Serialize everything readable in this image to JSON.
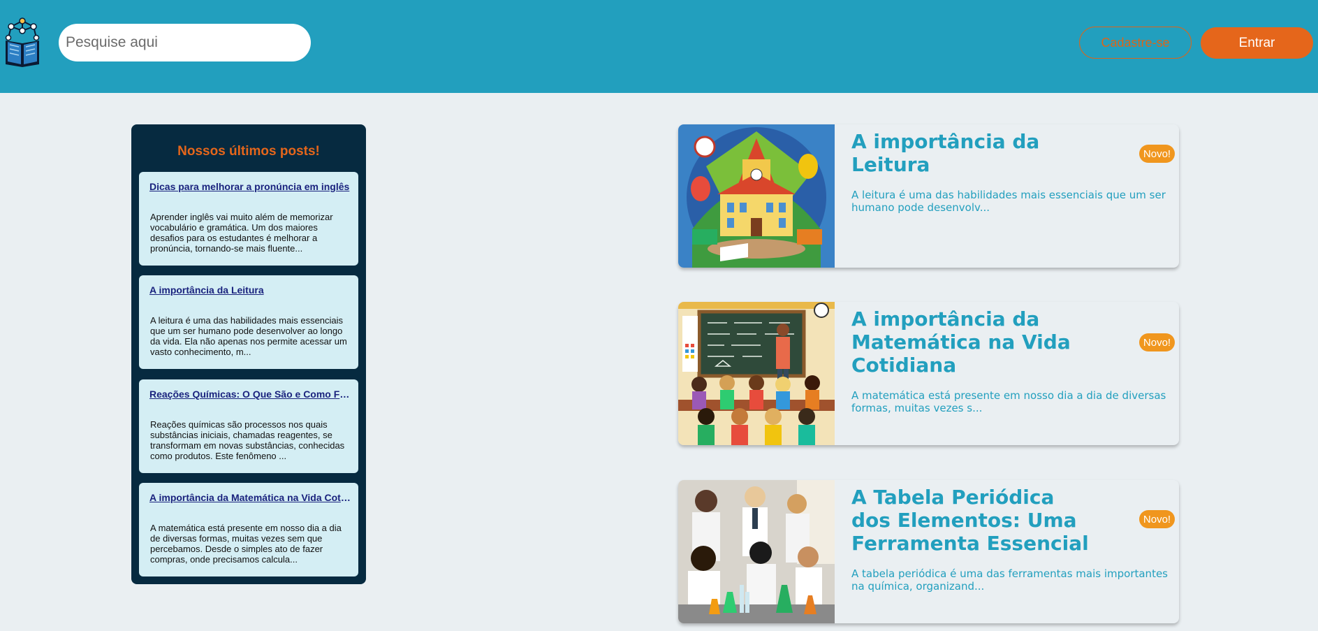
{
  "header": {
    "logo_icon": "book-network-icon",
    "search_placeholder": "Pesquise aqui",
    "signup_label": "Cadastre-se",
    "login_label": "Entrar"
  },
  "sidebar": {
    "title": "Nossos últimos posts!",
    "posts": [
      {
        "title": "Dicas para melhorar a pronúncia em inglês",
        "excerpt": "Aprender inglês vai muito além de memorizar vocabulário e gramática. Um dos maiores desafios para os estudantes é melhorar a pronúncia, tornando-se mais fluente..."
      },
      {
        "title": "A importância da Leitura",
        "excerpt": "A leitura é uma das habilidades mais essenciais que um ser humano pode desenvolver ao longo da vida. Ela não apenas nos permite acessar um vasto conhecimento, m..."
      },
      {
        "title": "Reações Químicas: O Que São e Como Funcionam",
        "excerpt": "Reações químicas são processos nos quais substâncias iniciais, chamadas reagentes, se transformam em novas substâncias, conhecidas como produtos. Este fenômeno ..."
      },
      {
        "title": "A importância da Matemática na Vida Cotidiana",
        "excerpt": "A matemática está presente em nosso dia a dia de diversas formas, muitas vezes sem que percebamos. Desde o simples ato de fazer compras, onde precisamos calcula..."
      }
    ]
  },
  "feed": {
    "posts": [
      {
        "title": "A importância da Leitura",
        "badge": "Novo!",
        "excerpt": "A leitura é uma das habilidades mais essenciais que um ser humano pode desenvolv..."
      },
      {
        "title": "A importância da Matemática na Vida Cotidiana",
        "badge": "Novo!",
        "excerpt": "A matemática está presente em nosso dia a dia de diversas formas, muitas vezes s..."
      },
      {
        "title": "A Tabela Periódica dos Elementos: Uma Ferramenta Essencial",
        "badge": "Novo!",
        "excerpt": "A tabela periódica é uma das ferramentas mais importantes na química, organizand..."
      }
    ]
  },
  "colors": {
    "header_bg": "#229fbe",
    "accent_orange": "#e5661b",
    "sidebar_bg": "#062a40",
    "sidebar_card_bg": "#d4eef4",
    "badge_bg": "#f0961e",
    "page_bg": "#eaeff2"
  }
}
